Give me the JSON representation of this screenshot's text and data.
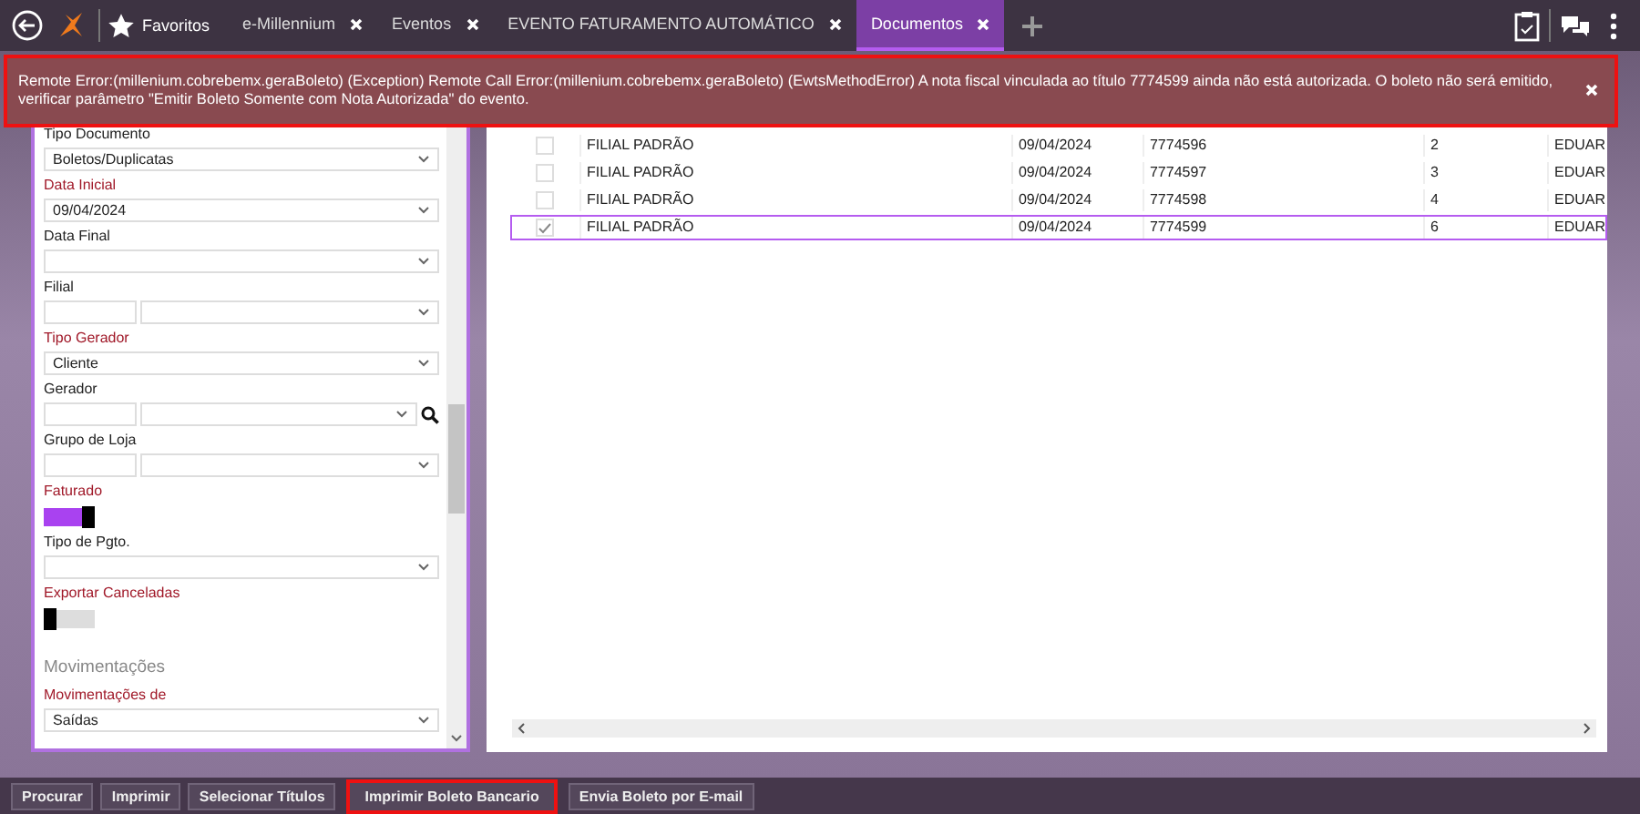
{
  "topbar": {
    "favorites": "Favoritos",
    "tabs": [
      {
        "label": "e-Millennium",
        "selected": false
      },
      {
        "label": "Eventos",
        "selected": false
      },
      {
        "label": "EVENTO FATURAMENTO AUTOMÁTICO",
        "selected": false
      },
      {
        "label": "Documentos",
        "selected": true
      }
    ]
  },
  "error_banner": {
    "message": "Remote Error:(millenium.cobrebemx.geraBoleto) (Exception) Remote Call Error:(millenium.cobrebemx.geraBoleto) (EwtsMethodError) A nota fiscal vinculada ao título 7774599 ainda não está autorizada. O boleto não será emitido, verificar parâmetro \"Emitir Boleto Somente com Nota Autorizada\" do evento.",
    "highlighted": true
  },
  "filters": [
    {
      "kind": "select",
      "label": "Tipo Documento",
      "required": false,
      "value": "Boletos/Duplicatas"
    },
    {
      "kind": "select",
      "label": "Data Inicial",
      "required": true,
      "value": "09/04/2024"
    },
    {
      "kind": "select",
      "label": "Data Final",
      "required": false
    },
    {
      "kind": "pair",
      "label": "Filial",
      "required": false
    },
    {
      "kind": "select",
      "label": "Tipo Gerador",
      "required": true,
      "value": "Cliente"
    },
    {
      "kind": "lookup",
      "label": "Gerador",
      "required": false
    },
    {
      "kind": "pair",
      "label": "Grupo de Loja",
      "required": false
    },
    {
      "kind": "toggle",
      "label": "Faturado",
      "required": true,
      "on": true
    },
    {
      "kind": "select",
      "label": "Tipo de Pgto.",
      "required": false
    },
    {
      "kind": "toggle",
      "label": "Exportar Canceladas",
      "required": true,
      "on": false
    },
    {
      "kind": "heading",
      "label": "Movimentações"
    },
    {
      "kind": "select",
      "label": "Movimentações de",
      "required": true,
      "value": "Saídas"
    }
  ],
  "table": {
    "rows": [
      {
        "checked": false,
        "selected": false,
        "filial": "FILIAL PADRÃO",
        "data": "09/04/2024",
        "nota": "7774596",
        "valor": "2",
        "cliente": "EDUAR"
      },
      {
        "checked": false,
        "selected": false,
        "filial": "FILIAL PADRÃO",
        "data": "09/04/2024",
        "nota": "7774597",
        "valor": "3",
        "cliente": "EDUAR"
      },
      {
        "checked": false,
        "selected": false,
        "filial": "FILIAL PADRÃO",
        "data": "09/04/2024",
        "nota": "7774598",
        "valor": "4",
        "cliente": "EDUAR"
      },
      {
        "checked": true,
        "selected": true,
        "filial": "FILIAL PADRÃO",
        "data": "09/04/2024",
        "nota": "7774599",
        "valor": "6",
        "cliente": "EDUAR"
      }
    ]
  },
  "actions": [
    {
      "label": "Procurar",
      "highlighted": false
    },
    {
      "label": "Imprimir",
      "highlighted": false
    },
    {
      "label": "Selecionar Títulos",
      "highlighted": false
    },
    {
      "label": "Imprimir Boleto Bancario",
      "highlighted": true
    },
    {
      "label": "Envia Boleto por E-mail",
      "highlighted": false
    }
  ]
}
